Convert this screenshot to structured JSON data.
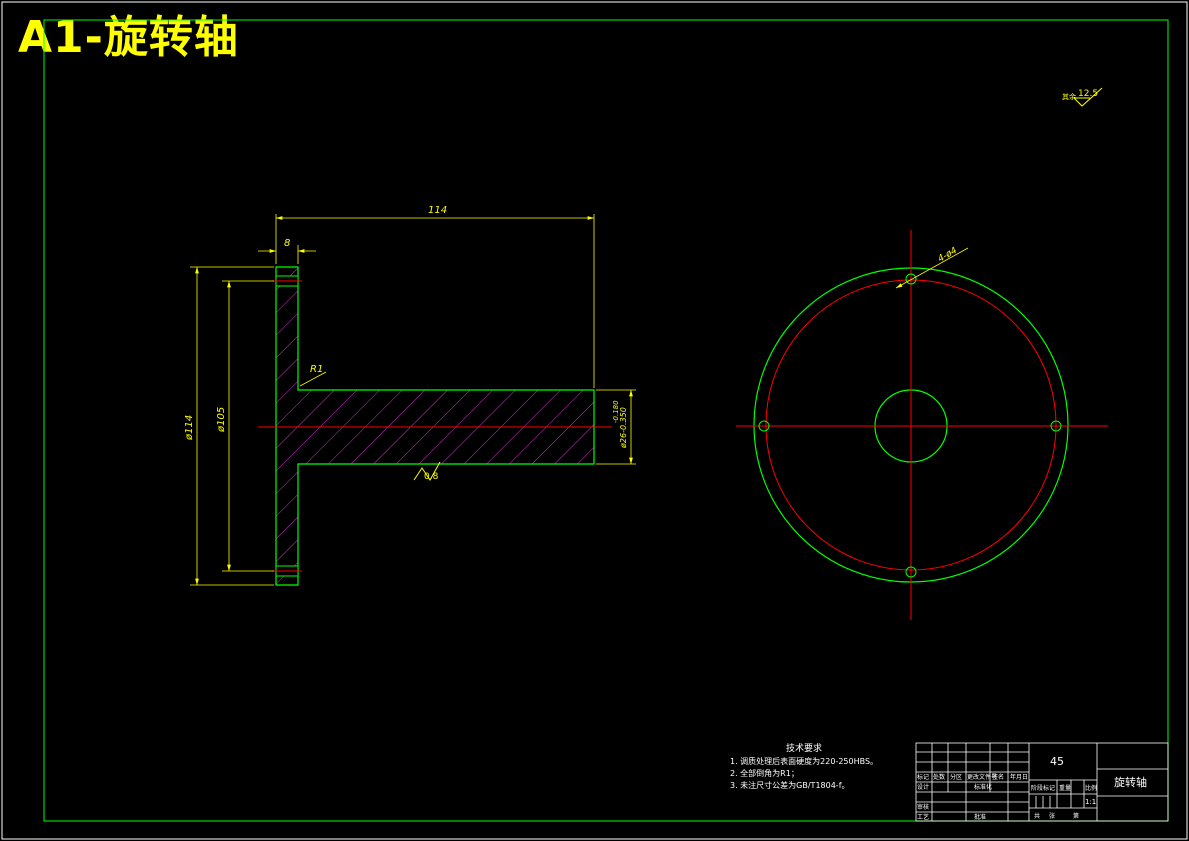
{
  "title": "A1-旋转轴",
  "colors": {
    "background": "#000000",
    "frame": "#00ff00",
    "dimension": "#ffff00",
    "hatch": "#cc33cc",
    "centerline": "#ff0000",
    "text": "#ffffff"
  },
  "roughness": {
    "corner_prefix": "其余",
    "corner_value": "12.5",
    "shaft_value": "0.8"
  },
  "dimensions": {
    "shaft_length": "114",
    "flange_thickness": "8",
    "flange_diameter": "ø114",
    "bolt_circle": "ø105",
    "shaft_diameter": "ø26-0.350",
    "shaft_tol_top": "-0.180",
    "fillet": "R1",
    "holes": "4-ø4"
  },
  "notes": {
    "heading": "技术要求",
    "items": [
      "1. 调质处理后表面硬度为220-250HBS。",
      "2. 全部倒角为R1；",
      "3. 未注尺寸公差为GB/T1804-f。"
    ]
  },
  "title_block": {
    "material": "45",
    "part_name": "旋转轴",
    "scale": "1:1",
    "cells": {
      "mark": "标记",
      "count": "处数",
      "zone": "分区",
      "change_doc": "更改文件号",
      "signature": "签名",
      "date": "年月日",
      "designer": "设计",
      "standardize": "标准化",
      "review": "审核",
      "process": "工艺",
      "approve": "批准",
      "stage_mark": "阶段标记",
      "weight": "重量",
      "ratio": "比例",
      "total": "共",
      "sheet": "张",
      "page": "第"
    }
  }
}
